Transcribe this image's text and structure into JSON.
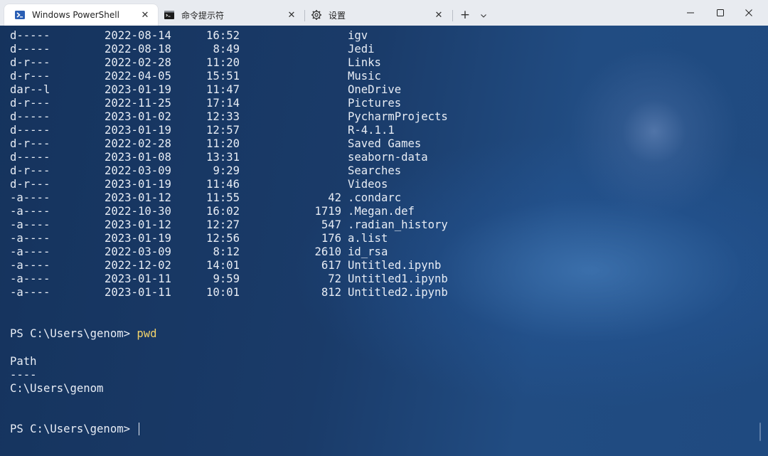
{
  "tabs": [
    {
      "label": "Windows PowerShell",
      "icon": "powershell-icon",
      "active": true
    },
    {
      "label": "命令提示符",
      "icon": "cmd-icon",
      "active": false
    },
    {
      "label": "设置",
      "icon": "gear-icon",
      "active": false
    }
  ],
  "window_controls": {
    "minimize": "─",
    "maximize": "☐",
    "close": "✕"
  },
  "new_tab_label": "+",
  "close_glyph": "✕",
  "listing": [
    {
      "mode": "d-----",
      "date": "2022-08-14",
      "time": "16:52",
      "size": "",
      "name": "igv"
    },
    {
      "mode": "d-----",
      "date": "2022-08-18",
      "time": "8:49",
      "size": "",
      "name": "Jedi"
    },
    {
      "mode": "d-r---",
      "date": "2022-02-28",
      "time": "11:20",
      "size": "",
      "name": "Links"
    },
    {
      "mode": "d-r---",
      "date": "2022-04-05",
      "time": "15:51",
      "size": "",
      "name": "Music"
    },
    {
      "mode": "dar--l",
      "date": "2023-01-19",
      "time": "11:47",
      "size": "",
      "name": "OneDrive"
    },
    {
      "mode": "d-r---",
      "date": "2022-11-25",
      "time": "17:14",
      "size": "",
      "name": "Pictures"
    },
    {
      "mode": "d-----",
      "date": "2023-01-02",
      "time": "12:33",
      "size": "",
      "name": "PycharmProjects"
    },
    {
      "mode": "d-----",
      "date": "2023-01-19",
      "time": "12:57",
      "size": "",
      "name": "R-4.1.1"
    },
    {
      "mode": "d-r---",
      "date": "2022-02-28",
      "time": "11:20",
      "size": "",
      "name": "Saved Games"
    },
    {
      "mode": "d-----",
      "date": "2023-01-08",
      "time": "13:31",
      "size": "",
      "name": "seaborn-data"
    },
    {
      "mode": "d-r---",
      "date": "2022-03-09",
      "time": "9:29",
      "size": "",
      "name": "Searches"
    },
    {
      "mode": "d-r---",
      "date": "2023-01-19",
      "time": "11:46",
      "size": "",
      "name": "Videos"
    },
    {
      "mode": "-a----",
      "date": "2023-01-12",
      "time": "11:55",
      "size": "42",
      "name": ".condarc"
    },
    {
      "mode": "-a----",
      "date": "2022-10-30",
      "time": "16:02",
      "size": "1719",
      "name": ".Megan.def"
    },
    {
      "mode": "-a----",
      "date": "2023-01-12",
      "time": "12:27",
      "size": "547",
      "name": ".radian_history"
    },
    {
      "mode": "-a----",
      "date": "2023-01-19",
      "time": "12:56",
      "size": "176",
      "name": "a.list"
    },
    {
      "mode": "-a----",
      "date": "2022-03-09",
      "time": "8:12",
      "size": "2610",
      "name": "id_rsa"
    },
    {
      "mode": "-a----",
      "date": "2022-12-02",
      "time": "14:01",
      "size": "617",
      "name": "Untitled.ipynb"
    },
    {
      "mode": "-a----",
      "date": "2023-01-11",
      "time": "9:59",
      "size": "72",
      "name": "Untitled1.ipynb"
    },
    {
      "mode": "-a----",
      "date": "2023-01-11",
      "time": "10:01",
      "size": "812",
      "name": "Untitled2.ipynb"
    }
  ],
  "prompt1": "PS C:\\Users\\genom> ",
  "command1": "pwd",
  "output_header": "Path",
  "output_rule": "----",
  "output_path": "C:\\Users\\genom",
  "prompt2": "PS C:\\Users\\genom> ",
  "colors": {
    "command": "#f2d36b",
    "text": "#e8edf5",
    "tabbar": "#e8ebf0"
  }
}
